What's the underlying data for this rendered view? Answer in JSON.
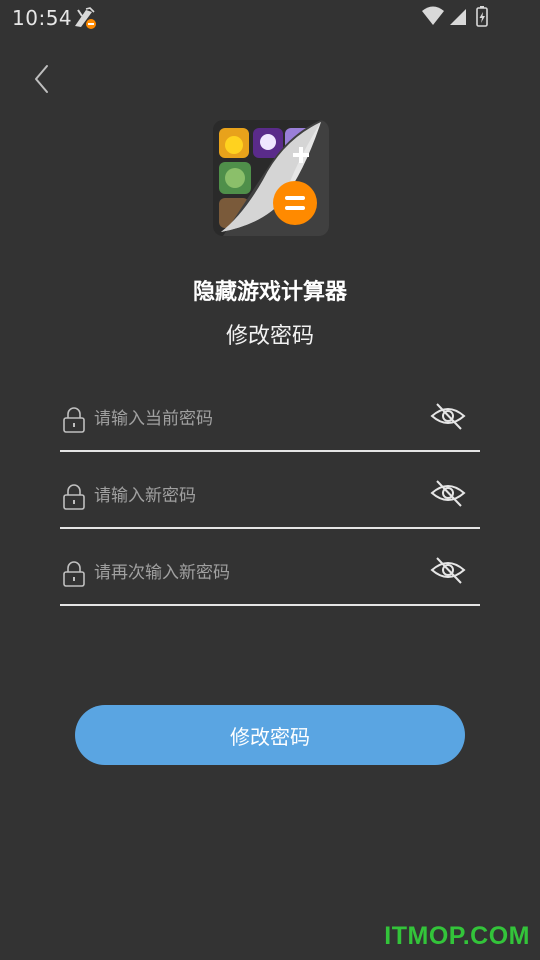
{
  "status_bar": {
    "time": "10:54",
    "icons": [
      "notification-icon",
      "wifi-icon",
      "cellular-signal-icon",
      "battery-icon"
    ]
  },
  "header": {
    "back_icon": "back-chevron-icon",
    "app_icon": "app-icon",
    "app_name": "隐藏游戏计算器",
    "page_title": "修改密码"
  },
  "form": {
    "fields": [
      {
        "placeholder": "请输入当前密码",
        "value": "",
        "lock_icon": "lock-icon",
        "toggle_icon": "eye-hidden-icon"
      },
      {
        "placeholder": "请输入新密码",
        "value": "",
        "lock_icon": "lock-icon",
        "toggle_icon": "eye-hidden-icon"
      },
      {
        "placeholder": "请再次输入新密码",
        "value": "",
        "lock_icon": "lock-icon",
        "toggle_icon": "eye-hidden-icon"
      }
    ],
    "submit_label": "修改密码"
  },
  "watermark": "ITMOP.COM",
  "colors": {
    "background": "#333333",
    "button": "#5aa5e2",
    "divider": "#e5e5e5",
    "icon_accent": "#ff8a00",
    "watermark": "#33c43a"
  }
}
